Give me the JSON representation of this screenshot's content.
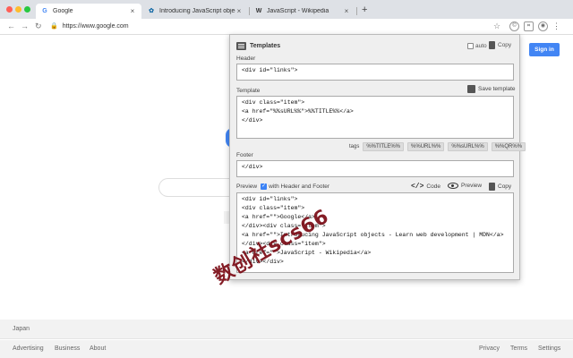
{
  "browser": {
    "tabs": [
      {
        "favicon": "G",
        "title": "Google",
        "favicon_color": "#4285f4"
      },
      {
        "favicon": "✿",
        "title": "Introducing JavaScript objects",
        "favicon_color": "#1b6ea8"
      },
      {
        "favicon": "W",
        "title": "JavaScript - Wikipedia",
        "favicon_color": "#333333"
      }
    ],
    "new_tab_icon": "plus-icon",
    "url": "https://www.google.com",
    "nav_icons": [
      "back-arrow-icon",
      "forward-arrow-icon",
      "reload-icon"
    ],
    "toolbar_icons": [
      "star-icon",
      "extension-icon",
      "extension-templates-icon",
      "menu-icon"
    ]
  },
  "google": {
    "sign_in_label": "Sign in",
    "country": "Japan",
    "footer_left": [
      "Advertising",
      "Business",
      "About"
    ],
    "footer_right": [
      "Privacy",
      "Terms",
      "Settings"
    ]
  },
  "popup": {
    "title": "Templates",
    "auto_label": "auto",
    "copy_label": "Copy",
    "header_label": "Header",
    "header_value": "<div id=\"links\">",
    "template_label": "Template",
    "save_template_label": "Save template",
    "template_value": "<div class=\"item\">\n<a href=\"%%sURL%%\">%%TITLE%%</a>\n</div>",
    "tags_label": "tags",
    "tags": [
      "%%TITLE%%",
      "%%URL%%",
      "%%sURL%%",
      "%%QR%%"
    ],
    "footer_label": "Footer",
    "footer_value": "</div>",
    "preview_label": "Preview",
    "with_header_footer_label": "with Header and Footer",
    "with_header_footer_checked": true,
    "code_label": "Code",
    "preview_button_label": "Preview",
    "preview_copy_label": "Copy",
    "preview_value": "<div id=\"links\">\n<div class=\"item\">\n<a href=\"\">Google</a>\n</div><div class=\"item\">\n<a href=\"\">Introducing JavaScript objects - Learn web development | MDN</a>\n</div><div class=\"item\">\n<a href=\"\">JavaScript - Wikipedia</a>\n</div></div>"
  },
  "watermark": "数创社scs66"
}
